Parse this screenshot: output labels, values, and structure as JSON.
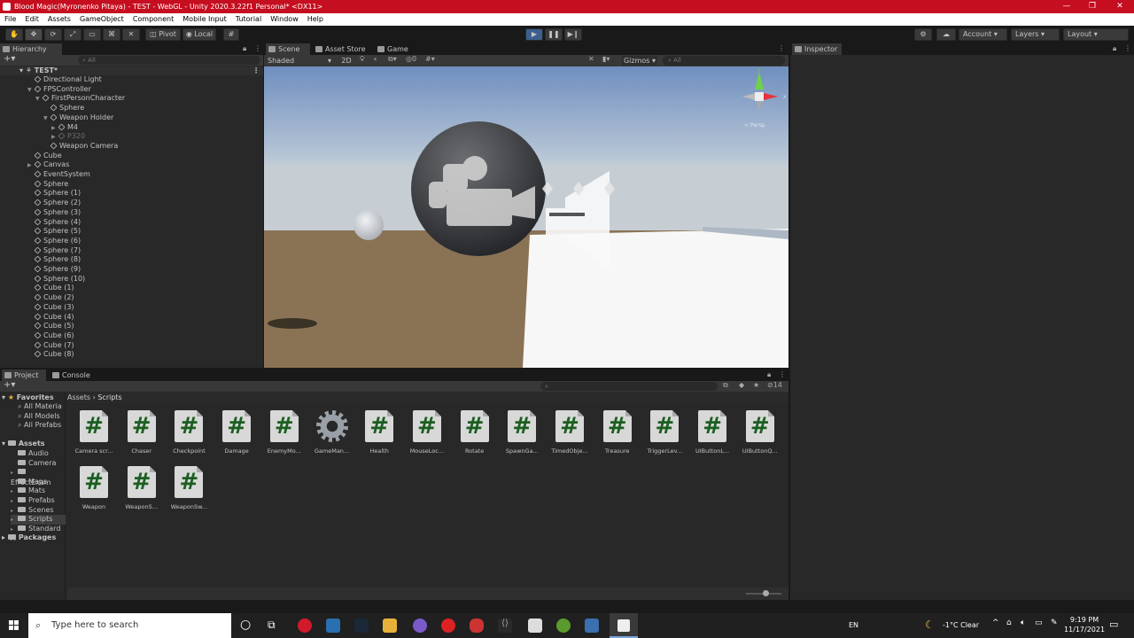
{
  "window": {
    "title": "Blood Magic(Myronenko Pitaya) - TEST - WebGL - Unity 2020.3.22f1 Personal* <DX11>",
    "controls": [
      "—",
      "❐",
      "✕"
    ]
  },
  "menu": [
    "File",
    "Edit",
    "Assets",
    "GameObject",
    "Component",
    "Mobile Input",
    "Tutorial",
    "Window",
    "Help"
  ],
  "toolbar": {
    "pivot": "Pivot",
    "local": "Local",
    "account": "Account",
    "layers": "Layers",
    "layout": "Layout"
  },
  "hierarchy": {
    "tab": "Hierarchy",
    "search_placeholder": "All",
    "scene": "TEST*",
    "items": [
      {
        "label": "Directional Light",
        "indent": 1,
        "arrow": false
      },
      {
        "label": "FPSController",
        "indent": 1,
        "arrow": true
      },
      {
        "label": "FirstPersonCharacter",
        "indent": 2,
        "arrow": true
      },
      {
        "label": "Sphere",
        "indent": 3,
        "arrow": false
      },
      {
        "label": "Weapon Holder",
        "indent": 3,
        "arrow": true
      },
      {
        "label": "M4",
        "indent": 4,
        "arrow": true
      },
      {
        "label": "P320",
        "indent": 4,
        "arrow": true,
        "dim": true
      },
      {
        "label": "Weapon Camera",
        "indent": 3,
        "arrow": false
      },
      {
        "label": "Cube",
        "indent": 1,
        "arrow": false
      },
      {
        "label": "Canvas",
        "indent": 1,
        "arrow": true
      },
      {
        "label": "EventSystem",
        "indent": 1,
        "arrow": false
      },
      {
        "label": "Sphere",
        "indent": 1,
        "arrow": false
      },
      {
        "label": "Sphere (1)",
        "indent": 1,
        "arrow": false
      },
      {
        "label": "Sphere (2)",
        "indent": 1,
        "arrow": false
      },
      {
        "label": "Sphere (3)",
        "indent": 1,
        "arrow": false
      },
      {
        "label": "Sphere (4)",
        "indent": 1,
        "arrow": false
      },
      {
        "label": "Sphere (5)",
        "indent": 1,
        "arrow": false
      },
      {
        "label": "Sphere (6)",
        "indent": 1,
        "arrow": false
      },
      {
        "label": "Sphere (7)",
        "indent": 1,
        "arrow": false
      },
      {
        "label": "Sphere (8)",
        "indent": 1,
        "arrow": false
      },
      {
        "label": "Sphere (9)",
        "indent": 1,
        "arrow": false
      },
      {
        "label": "Sphere (10)",
        "indent": 1,
        "arrow": false
      },
      {
        "label": "Cube (1)",
        "indent": 1,
        "arrow": false
      },
      {
        "label": "Cube (2)",
        "indent": 1,
        "arrow": false
      },
      {
        "label": "Cube (3)",
        "indent": 1,
        "arrow": false
      },
      {
        "label": "Cube (4)",
        "indent": 1,
        "arrow": false
      },
      {
        "label": "Cube (5)",
        "indent": 1,
        "arrow": false
      },
      {
        "label": "Cube (6)",
        "indent": 1,
        "arrow": false
      },
      {
        "label": "Cube (7)",
        "indent": 1,
        "arrow": false
      },
      {
        "label": "Cube (8)",
        "indent": 1,
        "arrow": false
      }
    ]
  },
  "scene": {
    "tabs": [
      "Scene",
      "Asset Store",
      "Game"
    ],
    "shading": "Shaded",
    "mode2d": "2D",
    "gizmos": "Gizmos",
    "search_placeholder": "All",
    "hidden_count": "0",
    "persp_label": "< Persp"
  },
  "inspector": {
    "tab": "Inspector"
  },
  "project": {
    "tabs": [
      "Project",
      "Console"
    ],
    "breadcrumb": [
      "Assets",
      "Scripts"
    ],
    "hidden_count": "14",
    "favorites": {
      "label": "Favorites",
      "items": [
        "All Materia",
        "All Models",
        "All Prefabs"
      ]
    },
    "assets": {
      "label": "Assets",
      "items": [
        "Audio",
        "Camera",
        "EffectExam",
        "Maps",
        "Mats",
        "Prefabs",
        "Scenes",
        "Scripts",
        "Standard A"
      ]
    },
    "packages": "Packages",
    "files": [
      {
        "name": "Camera scr...",
        "type": "script"
      },
      {
        "name": "Chaser",
        "type": "script"
      },
      {
        "name": "Checkpoint",
        "type": "script"
      },
      {
        "name": "Damage",
        "type": "script"
      },
      {
        "name": "EnemyMo...",
        "type": "script"
      },
      {
        "name": "GameMan...",
        "type": "gear"
      },
      {
        "name": "Health",
        "type": "script"
      },
      {
        "name": "MouseLoc...",
        "type": "script"
      },
      {
        "name": "Rotate",
        "type": "script"
      },
      {
        "name": "SpawnGa...",
        "type": "script"
      },
      {
        "name": "TimedObje...",
        "type": "script"
      },
      {
        "name": "Treasure",
        "type": "script"
      },
      {
        "name": "TriggerLev...",
        "type": "script"
      },
      {
        "name": "UIButtonL...",
        "type": "script"
      },
      {
        "name": "UIButtonQ...",
        "type": "script"
      },
      {
        "name": "Weapon",
        "type": "script"
      },
      {
        "name": "WeaponS...",
        "type": "script"
      },
      {
        "name": "WeaponSw...",
        "type": "script"
      }
    ]
  },
  "taskbar": {
    "search_placeholder": "Type here to search",
    "language": "EN",
    "weather": "-1°C  Clear",
    "time": "9:19 PM",
    "date": "11/17/2021"
  },
  "colors": {
    "titlebar": "#c50e1f",
    "sky_top": "#6f8fbf",
    "ground": "#8a7355",
    "script_hash": "#1b5e20"
  }
}
